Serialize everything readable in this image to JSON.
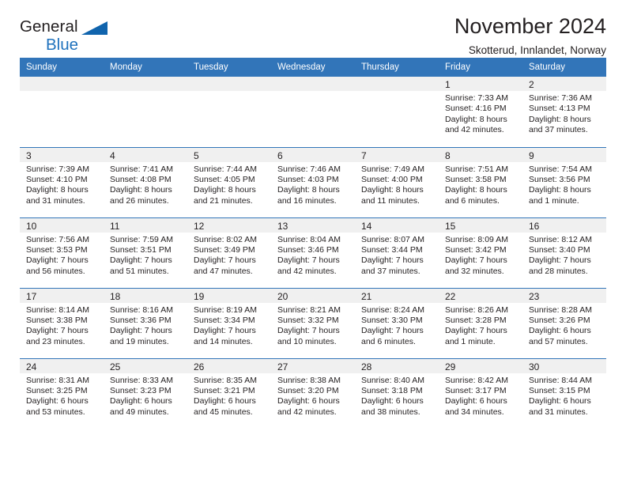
{
  "brand": {
    "name_part1": "General",
    "name_part2": "Blue",
    "triangle_color": "#1064ad",
    "blue_color": "#1f72bd"
  },
  "header": {
    "title": "November 2024",
    "subtitle": "Skotterud, Innlandet, Norway"
  },
  "calendar": {
    "header_color": "#3275b9",
    "daynum_bg": "#f0f0f0",
    "weekday_headers": [
      "Sunday",
      "Monday",
      "Tuesday",
      "Wednesday",
      "Thursday",
      "Friday",
      "Saturday"
    ],
    "weeks": [
      [
        {
          "day": "",
          "lines": []
        },
        {
          "day": "",
          "lines": []
        },
        {
          "day": "",
          "lines": []
        },
        {
          "day": "",
          "lines": []
        },
        {
          "day": "",
          "lines": []
        },
        {
          "day": "1",
          "lines": [
            "Sunrise: 7:33 AM",
            "Sunset: 4:16 PM",
            "Daylight: 8 hours",
            "and 42 minutes."
          ]
        },
        {
          "day": "2",
          "lines": [
            "Sunrise: 7:36 AM",
            "Sunset: 4:13 PM",
            "Daylight: 8 hours",
            "and 37 minutes."
          ]
        }
      ],
      [
        {
          "day": "3",
          "lines": [
            "Sunrise: 7:39 AM",
            "Sunset: 4:10 PM",
            "Daylight: 8 hours",
            "and 31 minutes."
          ]
        },
        {
          "day": "4",
          "lines": [
            "Sunrise: 7:41 AM",
            "Sunset: 4:08 PM",
            "Daylight: 8 hours",
            "and 26 minutes."
          ]
        },
        {
          "day": "5",
          "lines": [
            "Sunrise: 7:44 AM",
            "Sunset: 4:05 PM",
            "Daylight: 8 hours",
            "and 21 minutes."
          ]
        },
        {
          "day": "6",
          "lines": [
            "Sunrise: 7:46 AM",
            "Sunset: 4:03 PM",
            "Daylight: 8 hours",
            "and 16 minutes."
          ]
        },
        {
          "day": "7",
          "lines": [
            "Sunrise: 7:49 AM",
            "Sunset: 4:00 PM",
            "Daylight: 8 hours",
            "and 11 minutes."
          ]
        },
        {
          "day": "8",
          "lines": [
            "Sunrise: 7:51 AM",
            "Sunset: 3:58 PM",
            "Daylight: 8 hours",
            "and 6 minutes."
          ]
        },
        {
          "day": "9",
          "lines": [
            "Sunrise: 7:54 AM",
            "Sunset: 3:56 PM",
            "Daylight: 8 hours",
            "and 1 minute."
          ]
        }
      ],
      [
        {
          "day": "10",
          "lines": [
            "Sunrise: 7:56 AM",
            "Sunset: 3:53 PM",
            "Daylight: 7 hours",
            "and 56 minutes."
          ]
        },
        {
          "day": "11",
          "lines": [
            "Sunrise: 7:59 AM",
            "Sunset: 3:51 PM",
            "Daylight: 7 hours",
            "and 51 minutes."
          ]
        },
        {
          "day": "12",
          "lines": [
            "Sunrise: 8:02 AM",
            "Sunset: 3:49 PM",
            "Daylight: 7 hours",
            "and 47 minutes."
          ]
        },
        {
          "day": "13",
          "lines": [
            "Sunrise: 8:04 AM",
            "Sunset: 3:46 PM",
            "Daylight: 7 hours",
            "and 42 minutes."
          ]
        },
        {
          "day": "14",
          "lines": [
            "Sunrise: 8:07 AM",
            "Sunset: 3:44 PM",
            "Daylight: 7 hours",
            "and 37 minutes."
          ]
        },
        {
          "day": "15",
          "lines": [
            "Sunrise: 8:09 AM",
            "Sunset: 3:42 PM",
            "Daylight: 7 hours",
            "and 32 minutes."
          ]
        },
        {
          "day": "16",
          "lines": [
            "Sunrise: 8:12 AM",
            "Sunset: 3:40 PM",
            "Daylight: 7 hours",
            "and 28 minutes."
          ]
        }
      ],
      [
        {
          "day": "17",
          "lines": [
            "Sunrise: 8:14 AM",
            "Sunset: 3:38 PM",
            "Daylight: 7 hours",
            "and 23 minutes."
          ]
        },
        {
          "day": "18",
          "lines": [
            "Sunrise: 8:16 AM",
            "Sunset: 3:36 PM",
            "Daylight: 7 hours",
            "and 19 minutes."
          ]
        },
        {
          "day": "19",
          "lines": [
            "Sunrise: 8:19 AM",
            "Sunset: 3:34 PM",
            "Daylight: 7 hours",
            "and 14 minutes."
          ]
        },
        {
          "day": "20",
          "lines": [
            "Sunrise: 8:21 AM",
            "Sunset: 3:32 PM",
            "Daylight: 7 hours",
            "and 10 minutes."
          ]
        },
        {
          "day": "21",
          "lines": [
            "Sunrise: 8:24 AM",
            "Sunset: 3:30 PM",
            "Daylight: 7 hours",
            "and 6 minutes."
          ]
        },
        {
          "day": "22",
          "lines": [
            "Sunrise: 8:26 AM",
            "Sunset: 3:28 PM",
            "Daylight: 7 hours",
            "and 1 minute."
          ]
        },
        {
          "day": "23",
          "lines": [
            "Sunrise: 8:28 AM",
            "Sunset: 3:26 PM",
            "Daylight: 6 hours",
            "and 57 minutes."
          ]
        }
      ],
      [
        {
          "day": "24",
          "lines": [
            "Sunrise: 8:31 AM",
            "Sunset: 3:25 PM",
            "Daylight: 6 hours",
            "and 53 minutes."
          ]
        },
        {
          "day": "25",
          "lines": [
            "Sunrise: 8:33 AM",
            "Sunset: 3:23 PM",
            "Daylight: 6 hours",
            "and 49 minutes."
          ]
        },
        {
          "day": "26",
          "lines": [
            "Sunrise: 8:35 AM",
            "Sunset: 3:21 PM",
            "Daylight: 6 hours",
            "and 45 minutes."
          ]
        },
        {
          "day": "27",
          "lines": [
            "Sunrise: 8:38 AM",
            "Sunset: 3:20 PM",
            "Daylight: 6 hours",
            "and 42 minutes."
          ]
        },
        {
          "day": "28",
          "lines": [
            "Sunrise: 8:40 AM",
            "Sunset: 3:18 PM",
            "Daylight: 6 hours",
            "and 38 minutes."
          ]
        },
        {
          "day": "29",
          "lines": [
            "Sunrise: 8:42 AM",
            "Sunset: 3:17 PM",
            "Daylight: 6 hours",
            "and 34 minutes."
          ]
        },
        {
          "day": "30",
          "lines": [
            "Sunrise: 8:44 AM",
            "Sunset: 3:15 PM",
            "Daylight: 6 hours",
            "and 31 minutes."
          ]
        }
      ]
    ]
  }
}
